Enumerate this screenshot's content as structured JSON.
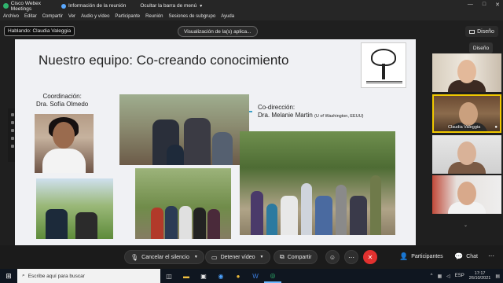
{
  "titlebar": {
    "app_name": "Cisco Webex Meetings",
    "meeting_info": "Información de la reunión",
    "hide_menu": "Ocultar la barra de menú",
    "window_controls": [
      "—",
      "□",
      "✕"
    ]
  },
  "menubar": {
    "items": [
      "Archivo",
      "Editar",
      "Compartir",
      "Ver",
      "Audio y vídeo",
      "Participante",
      "Reunión",
      "Sesiones de subgrupo",
      "Ayuda"
    ]
  },
  "stage": {
    "speaking_label": "Hablando: Claudia Valeggia",
    "view_tag": "Visualización de la(s) aplica...",
    "layout_button": "Diseño",
    "layout_tooltip": "Diseño"
  },
  "slide": {
    "title": "Nuestro equipo: Co-creando conocimiento",
    "coordination_heading": "Coordinación:",
    "coordination_name": "Dra. Sofía Olmedo",
    "codirection_heading": "Co-dirección:",
    "codirection_name": "Dra. Melanie Martin",
    "codirection_affiliation": "(U of Washington, EEUU)"
  },
  "participants": [
    {
      "name": "",
      "icon": "microphone-muted-icon"
    },
    {
      "name": "Claudia Valeggia",
      "icon": "microphone-icon"
    },
    {
      "name": "",
      "icon": "microphone-muted-icon"
    },
    {
      "name": "",
      "icon": "microphone-muted-icon"
    }
  ],
  "controls": {
    "mute": "Cancelar el silencio",
    "stop_video": "Detener vídeo",
    "share": "Compartir",
    "participants": "Participantes",
    "chat": "Chat"
  },
  "taskbar": {
    "search_placeholder": "Escribe aquí para buscar",
    "language": "ESP",
    "time": "17:17",
    "date": "26/10/2021"
  },
  "colors": {
    "end_call": "#e2312f",
    "active_speaker_border": "#f0c800",
    "arrow": "#3aa0c8"
  }
}
